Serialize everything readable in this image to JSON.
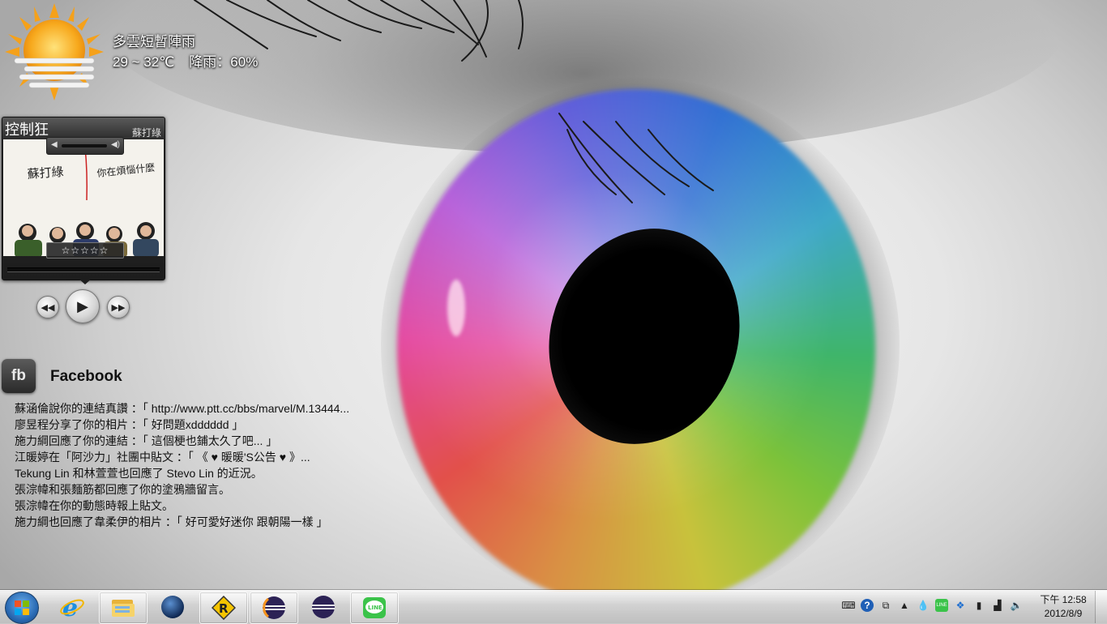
{
  "weather": {
    "condition": "多雲短暫陣雨",
    "temperature": "29 ~ 32℃",
    "rain": "降雨：60%",
    "icon": "sun-behind-clouds-icon"
  },
  "player": {
    "song_title": "控制狂",
    "artist": "蘇打綠",
    "rating_stars": "☆☆☆☆☆",
    "rating": 0,
    "cover_text_left": "蘇打綠",
    "cover_text_right": "你在煩惱什麼"
  },
  "facebook": {
    "title": "Facebook",
    "logo": "fb",
    "feed": [
      "蘇涵倫說你的連結真讚 ：「 http://www.ptt.cc/bbs/marvel/M.13444...",
      "廖昱程分享了你的相片 ：「 好問題xdddddd 」",
      "施力綱回應了你的連結 ：「 這個梗也鋪太久了吧... 」",
      "江暖婷在「阿沙力」社團中貼文 ：「 《 ♥ 暖暖'S公告 ♥ 》...",
      "Tekung Lin 和林萱萱也回應了 Stevo Lin 的近況。",
      "張淙幃和張麵筋都回應了你的塗鴉牆留言。",
      "張淙幃在你的動態時報上貼文。",
      "施力綱也回應了韋柔伊的相片 ：「 好可愛好迷你 跟朝陽一樣 」"
    ]
  },
  "taskbar": {
    "start_icon": "windows-logo-icon",
    "items": [
      {
        "name": "internet-explorer",
        "icon": "ie-icon",
        "pinned": false
      },
      {
        "name": "windows-explorer",
        "icon": "folder-icon",
        "pinned": true
      },
      {
        "name": "stellarium",
        "icon": "globe-icon",
        "pinned": false
      },
      {
        "name": "app-yellow",
        "icon": "yellow-app-icon",
        "pinned": true
      },
      {
        "name": "eclipse-1",
        "icon": "eclipse-icon",
        "pinned": true
      },
      {
        "name": "eclipse-2",
        "icon": "eclipse-icon",
        "pinned": false
      },
      {
        "name": "line",
        "icon": "line-icon",
        "pinned": true
      }
    ],
    "tray_icons": [
      "keyboard-icon",
      "help-icon",
      "show-hidden-icons-icon",
      "droplet-icon",
      "line-tray-icon",
      "dropbox-icon",
      "power-icon",
      "network-icon",
      "volume-icon"
    ],
    "clock_time": "下午 12:58",
    "clock_date": "2012/8/9"
  }
}
